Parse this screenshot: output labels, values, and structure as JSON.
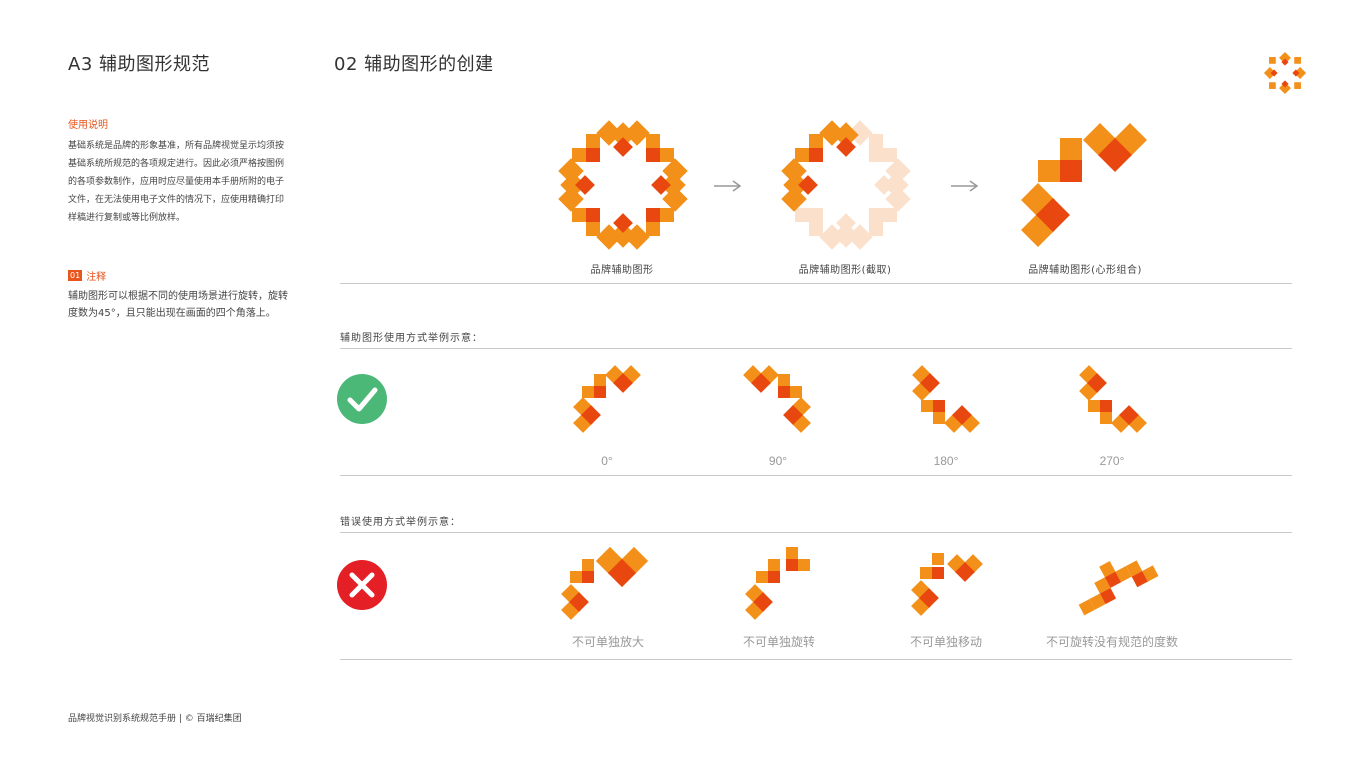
{
  "header": {
    "section_title": "A3 辅助图形规范",
    "page_heading": "02 辅助图形的创建",
    "logo_name": "logo-icon"
  },
  "sidebar": {
    "usage_heading": "使用说明",
    "usage_body": "基础系统是品牌的形象基准，所有品牌视觉呈示均须按基础系统所规范的各项规定进行。因此必须严格按图例的各项参数制作，应用时应尽量使用本手册所附的电子文件，在无法使用电子文件的情况下，应使用精确打印样稿进行复制或等比例放样。",
    "note_number": "01",
    "note_heading": "注释",
    "note_body": "辅助图形可以根据不同的使用场景进行旋转，旋转度数为45°，且只能出现在画面的四个角落上。"
  },
  "creation": {
    "captions": [
      "品牌辅助图形",
      "品牌辅助图形(截取)",
      "品牌辅助图形(心形组合)"
    ],
    "arrow_icon": "arrow-right-icon"
  },
  "correct": {
    "label": "辅助图形使用方式举例示意：",
    "icon": "check-icon",
    "angles": [
      "0°",
      "90°",
      "180°",
      "270°"
    ]
  },
  "incorrect": {
    "label": "错误使用方式举例示意：",
    "icon": "cross-icon",
    "captions": [
      "不可单独放大",
      "不可单独旋转",
      "不可单独移动",
      "不可旋转没有规范的度数"
    ]
  },
  "footer": {
    "text": "品牌视觉识别系统规范手册 | © 百瑞纪集团"
  },
  "colors": {
    "accent": "#e8561e",
    "orange": "#f39019",
    "deep": "#e8480f",
    "check": "#4cb878",
    "cross": "#e41f26"
  }
}
